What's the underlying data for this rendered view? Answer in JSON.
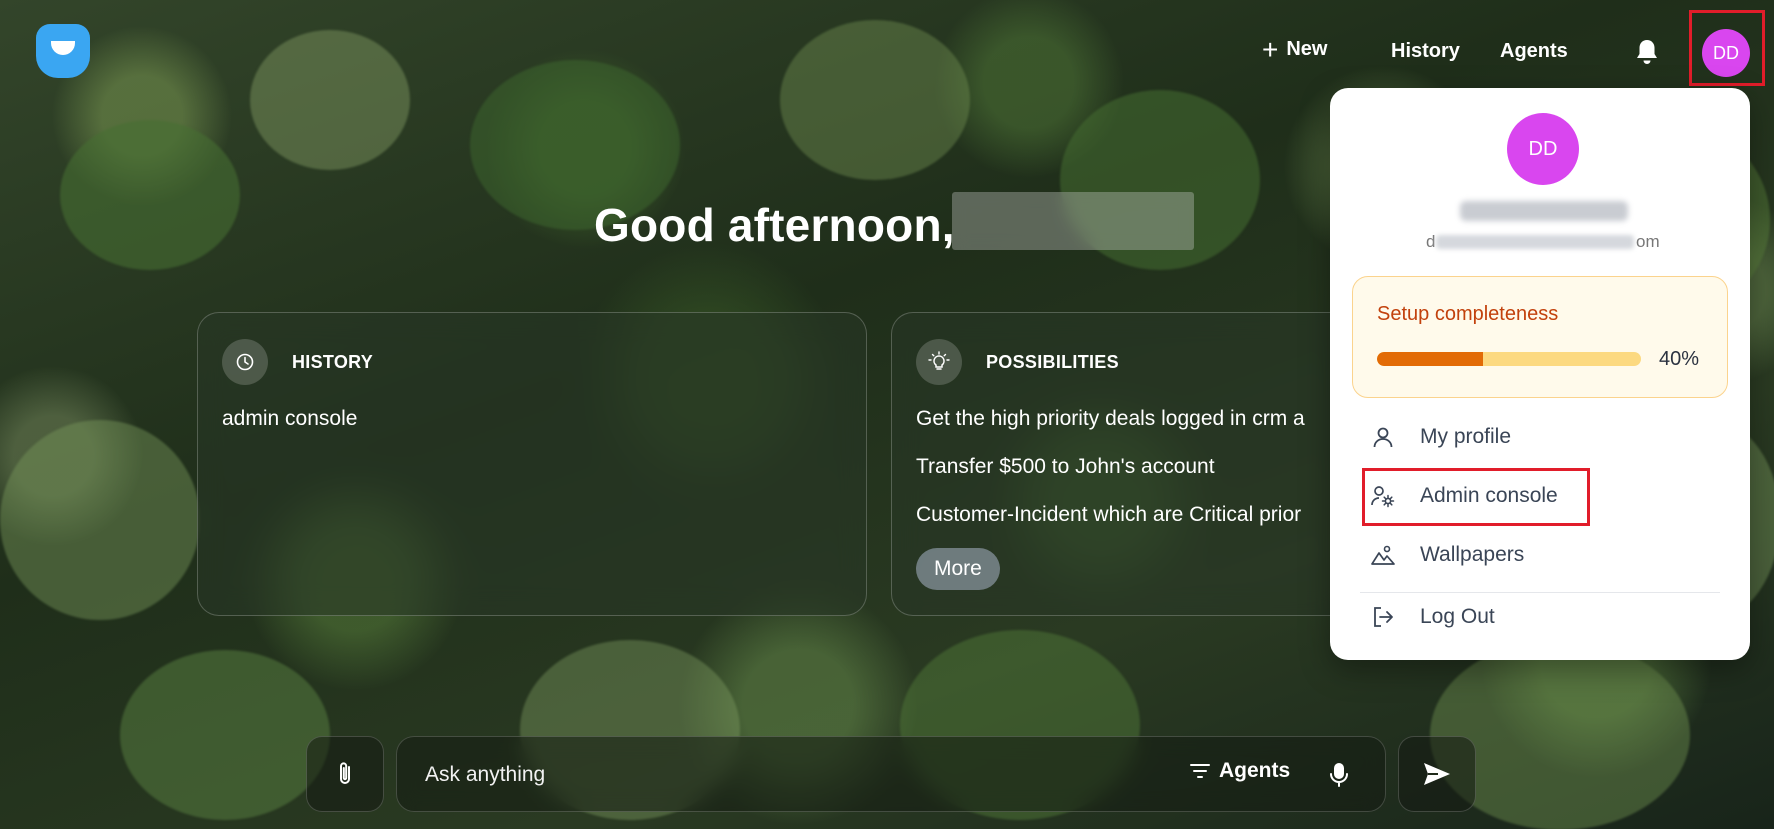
{
  "nav": {
    "new_label": "New",
    "history_label": "History",
    "agents_label": "Agents",
    "avatar_initials": "DD"
  },
  "greeting": {
    "text": "Good afternoon,"
  },
  "cards": {
    "history": {
      "title": "HISTORY",
      "items": [
        "admin console"
      ]
    },
    "possibilities": {
      "title": "POSSIBILITIES",
      "items": [
        "Get the high priority deals logged in crm a",
        "Transfer $500 to John's account",
        "Customer-Incident which are Critical prior"
      ],
      "more_label": "More"
    }
  },
  "composer": {
    "placeholder": "Ask anything",
    "agents_label": "Agents"
  },
  "profile_menu": {
    "avatar_initials": "DD",
    "email_visible_start": "d",
    "email_visible_end": "om",
    "setup": {
      "title": "Setup completeness",
      "percent_label": "40%",
      "percent_value": 0.4
    },
    "items": {
      "my_profile": "My profile",
      "admin_console": "Admin console",
      "wallpapers": "Wallpapers",
      "log_out": "Log Out"
    }
  },
  "colors": {
    "avatar": "#d946ef",
    "setup_title": "#c2410c",
    "progress_fill": "#e26b06",
    "progress_track": "#fcd980",
    "highlight_frame": "#e11d2a",
    "logo": "#3aa6f2"
  }
}
